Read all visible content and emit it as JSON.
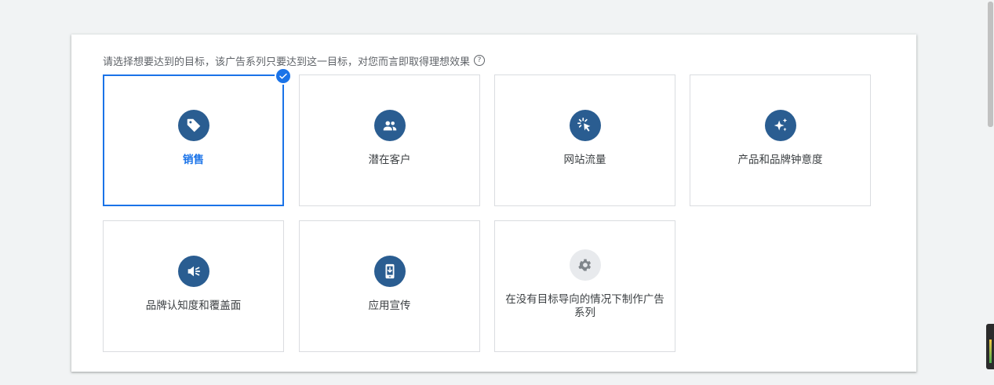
{
  "prompt": "请选择想要达到的目标，该广告系列只要达到这一目标，对您而言即取得理想效果",
  "help_icon_glyph": "?",
  "goals": [
    {
      "label": "销售",
      "icon": "tag-icon",
      "selected": true
    },
    {
      "label": "潜在客户",
      "icon": "people-icon",
      "selected": false
    },
    {
      "label": "网站流量",
      "icon": "cursor-click-icon",
      "selected": false
    },
    {
      "label": "产品和品牌钟意度",
      "icon": "sparkle-icon",
      "selected": false
    },
    {
      "label": "品牌认知度和覆盖面",
      "icon": "megaphone-icon",
      "selected": false
    },
    {
      "label": "应用宣传",
      "icon": "phone-download-icon",
      "selected": false
    },
    {
      "label": "在没有目标导向的情况下制作广告系列",
      "icon": "gear-icon",
      "selected": false
    }
  ],
  "colors": {
    "accent": "#1a73e8",
    "icon_bg": "#2a5d91",
    "border": "#dadce0"
  }
}
